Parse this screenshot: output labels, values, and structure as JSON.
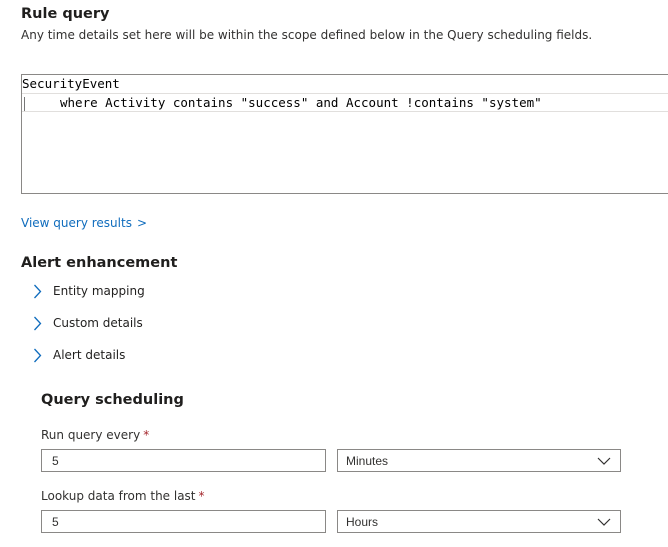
{
  "rule_query": {
    "title": "Rule query",
    "subtitle": "Any time details set here will be within the scope defined below in the Query scheduling fields.",
    "code_lines": [
      "SecurityEvent",
      "where Activity contains \"success\" and Account !contains \"system\""
    ],
    "view_results_link": "View query results",
    "view_results_chevron": ">"
  },
  "alert_enhancement": {
    "title": "Alert enhancement",
    "items": [
      {
        "label": "Entity mapping",
        "icon": "chevron-right-icon"
      },
      {
        "label": "Custom details",
        "icon": "chevron-right-icon"
      },
      {
        "label": "Alert details",
        "icon": "chevron-right-icon"
      }
    ]
  },
  "query_scheduling": {
    "title": "Query scheduling",
    "required_marker": "*",
    "run_every": {
      "label": "Run query every",
      "value": "5",
      "unit": "Minutes"
    },
    "lookup": {
      "label": "Lookup data from the last",
      "value": "5",
      "unit": "Hours"
    }
  },
  "colors": {
    "link": "#0f6cbd",
    "chevron": "#0f6cbd",
    "required": "#a4262c",
    "border": "#8a8886"
  }
}
